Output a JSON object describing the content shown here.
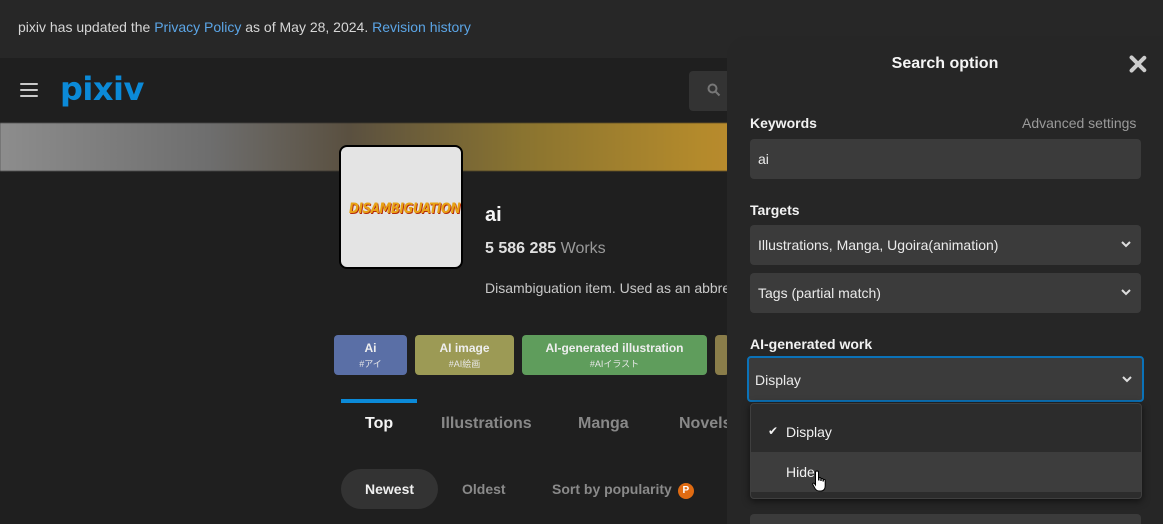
{
  "notice": {
    "text_before": "pixiv has updated the ",
    "privacy_link": "Privacy Policy",
    "text_middle": " as of May 28, 2024. ",
    "revision_link": "Revision history"
  },
  "header": {
    "logo": "pixiv"
  },
  "tag": {
    "thumbnail_text": "DISAMBIGUATION",
    "name": "ai",
    "works_count": "5 586 285",
    "works_label": "Works",
    "description": "Disambiguation item. Used as an abbreviation"
  },
  "related_tags": [
    {
      "title": "Ai",
      "sub": "#アイ",
      "color": "#5a6fa6"
    },
    {
      "title": "AI image",
      "sub": "#AI絵画",
      "color": "#9c9a55"
    },
    {
      "title": "AI-generated illustration",
      "sub": "#AIイラスト",
      "color": "#5f9d5c"
    }
  ],
  "tabs": [
    "Top",
    "Illustrations",
    "Manga",
    "Novels"
  ],
  "sort": {
    "newest": "Newest",
    "oldest": "Oldest",
    "popularity": "Sort by popularity",
    "badge": "P"
  },
  "search_option": {
    "title": "Search option",
    "keywords_label": "Keywords",
    "advanced": "Advanced settings",
    "keyword_value": "ai",
    "targets_label": "Targets",
    "target_value": "Illustrations, Manga, Ugoira(animation)",
    "match_value": "Tags (partial match)",
    "ai_label": "AI-generated work",
    "ai_value": "Display",
    "options": [
      "Display",
      "Hide"
    ],
    "check": "✔"
  }
}
